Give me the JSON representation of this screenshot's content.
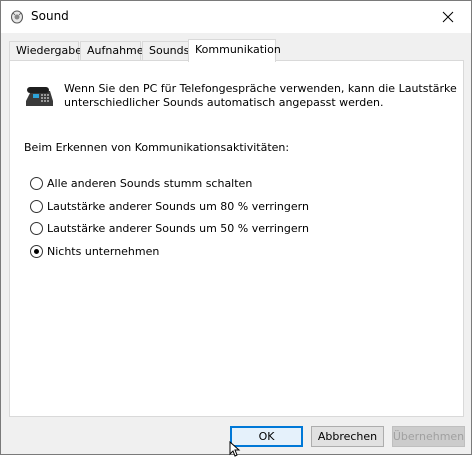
{
  "window": {
    "title": "Sound",
    "icon": "speaker-icon",
    "close_glyph": "✕"
  },
  "tabs": [
    {
      "label": "Wiedergabe",
      "active": false
    },
    {
      "label": "Aufnahme",
      "active": false
    },
    {
      "label": "Sounds",
      "active": false
    },
    {
      "label": "Kommunikation",
      "active": true
    }
  ],
  "panel": {
    "intro_icon": "telephone-icon",
    "intro_text": "Wenn Sie den PC für Telefongespräche verwenden, kann die Lautstärke unterschiedlicher Sounds automatisch angepasst werden.",
    "heading": "Beim Erkennen von Kommunikationsaktivitäten:",
    "options": [
      {
        "label": "Alle anderen Sounds stumm schalten",
        "checked": false
      },
      {
        "label": "Lautstärke anderer Sounds um 80 % verringern",
        "checked": false
      },
      {
        "label": "Lautstärke anderer Sounds um 50 % verringern",
        "checked": false
      },
      {
        "label": "Nichts unternehmen",
        "checked": true
      }
    ]
  },
  "buttons": {
    "ok": "OK",
    "cancel": "Abbrechen",
    "apply": "Übernehmen"
  },
  "colors": {
    "accent": "#0078d7",
    "dialog_bg": "#f0f0f0"
  }
}
